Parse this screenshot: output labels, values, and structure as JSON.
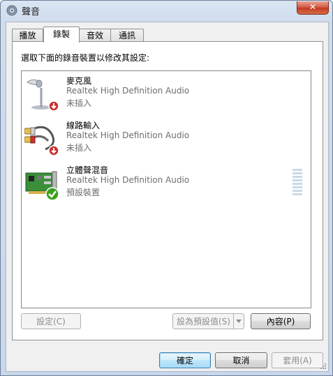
{
  "window": {
    "title": "聲音",
    "close_label": "✕"
  },
  "tabs": [
    {
      "label": "播放",
      "active": false
    },
    {
      "label": "錄製",
      "active": true
    },
    {
      "label": "音效",
      "active": false
    },
    {
      "label": "通訊",
      "active": false
    }
  ],
  "instruction": "選取下面的錄音裝置以修改其設定:",
  "devices": [
    {
      "name": "麥克風",
      "driver": "Realtek High Definition Audio",
      "status": "未插入",
      "icon": "microphone-icon",
      "badge": "unplugged-badge-icon"
    },
    {
      "name": "線路輸入",
      "driver": "Realtek High Definition Audio",
      "status": "未插入",
      "icon": "rca-cable-icon",
      "badge": "unplugged-badge-icon"
    },
    {
      "name": "立體聲混音",
      "driver": "Realtek High Definition Audio",
      "status": "預設裝置",
      "icon": "sound-card-icon",
      "badge": "default-check-icon",
      "level_meter_fraction": 0.0
    }
  ],
  "buttons": {
    "configure": "設定(C)",
    "set_default": "設為預設值(S)",
    "properties": "內容(P)",
    "ok": "確定",
    "cancel": "取消",
    "apply": "套用(A)"
  },
  "colors": {
    "status_text": "#6d6d6d",
    "default_check": "#3aa01c",
    "unplugged_badge": "#c8312d"
  }
}
